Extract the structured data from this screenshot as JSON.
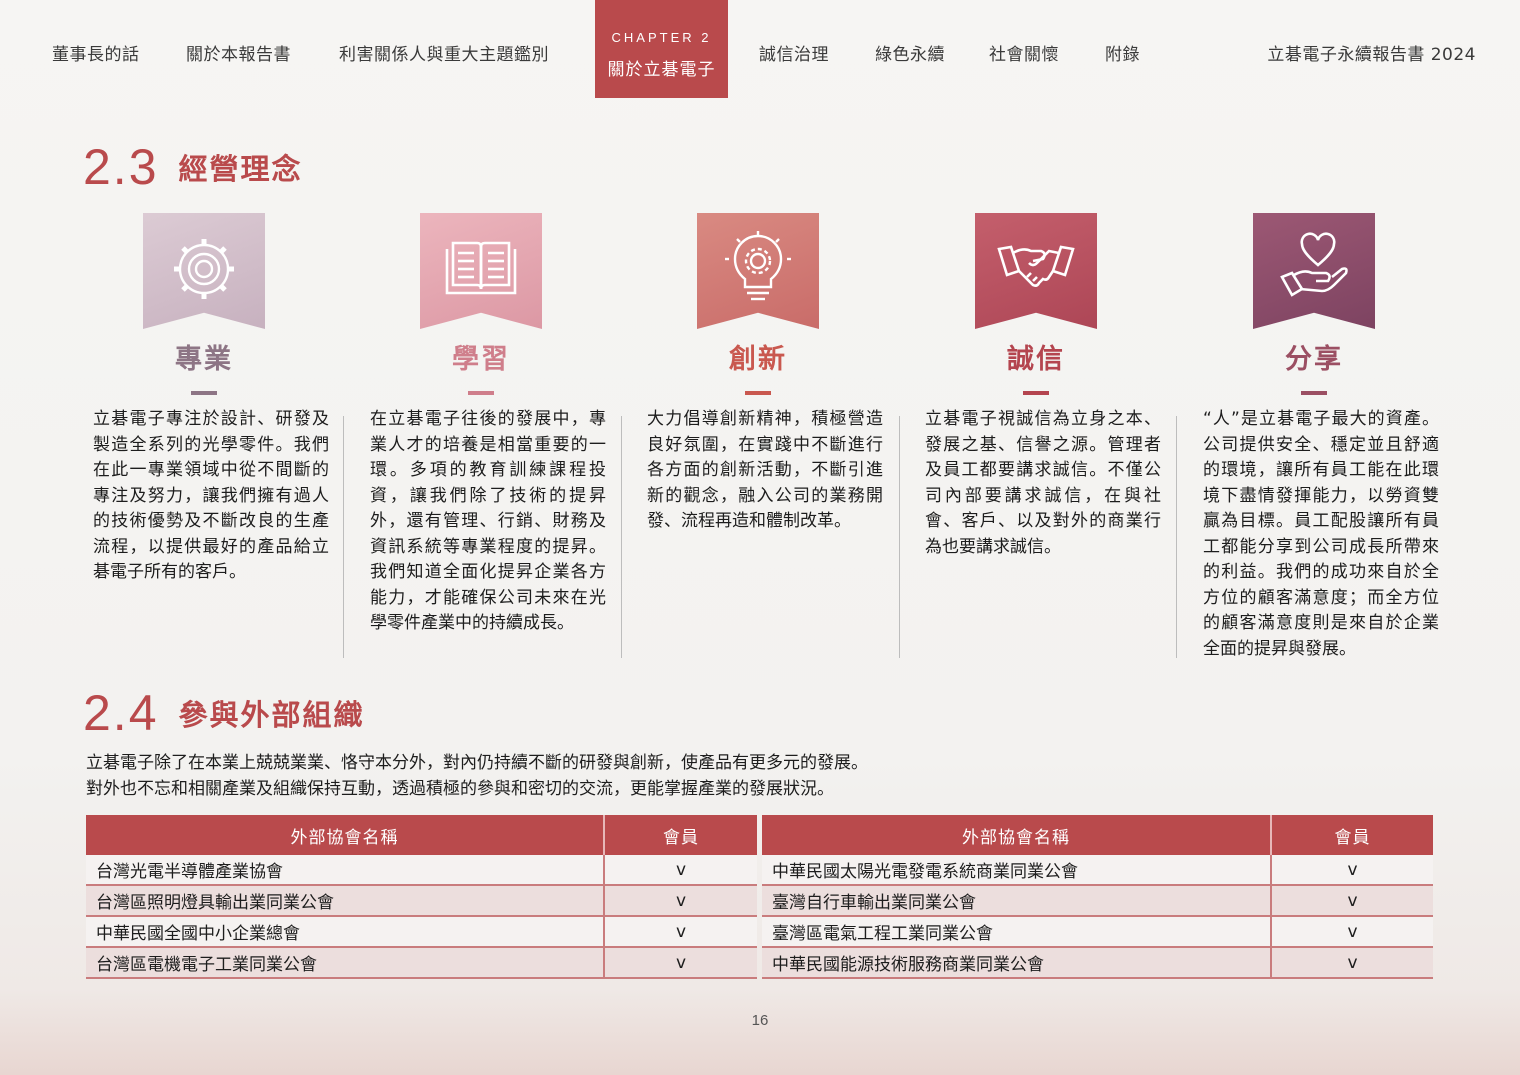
{
  "nav": {
    "items": [
      "董事長的話",
      "關於本報告書",
      "利害關係人與重大主題鑑別",
      "誠信治理",
      "綠色永續",
      "社會關懷",
      "附錄"
    ],
    "chapter_label": "CHAPTER 2",
    "chapter_name": "關於立碁電子",
    "report_title": "立碁電子永續報告書 2024"
  },
  "section_23": {
    "number": "2.3",
    "title": "經營理念"
  },
  "values": [
    {
      "name": "專業",
      "icon": "gear-icon",
      "color": "#8d7585",
      "banner": "#d4c3cc",
      "text": "立碁電子專注於設計、研發及製造全系列的光學零件。我們在此一專業領域中從不間斷的專注及努力，讓我們擁有過人的技術優勢及不斷改良的生產流程，以提供最好的產品給立碁電子所有的客戶。"
    },
    {
      "name": "學習",
      "icon": "book-icon",
      "color": "#cf7e8b",
      "banner": "#e3a2ad",
      "text": "在立碁電子往後的發展中，專業人才的培養是相當重要的一環。多項的教育訓練課程投資，讓我們除了技術的提昇外，還有管理、行銷、財務及資訊系統等專業程度的提昇。我們知道全面化提昇企業各方能力，才能確保公司未來在光學零件產業中的持續成長。"
    },
    {
      "name": "創新",
      "icon": "lightbulb-icon",
      "color": "#c9584f",
      "banner": "#cf7a75",
      "text": "大力倡導創新精神，積極營造良好氛圍，在實踐中不斷進行各方面的創新活動，不斷引進新的觀念，融入公司的業務開發、流程再造和體制改革。"
    },
    {
      "name": "誠信",
      "icon": "handshake-icon",
      "color": "#b4454f",
      "banner": "#b65261",
      "text": "立碁電子視誠信為立身之本、發展之基、信譽之源。管理者及員工都要講求誠信。不僅公司內部要講求誠信，在與社會、客戶、以及對外的商業行為也要講求誠信。"
    },
    {
      "name": "分享",
      "icon": "heart-hand-icon",
      "color": "#9b4f63",
      "banner": "#8f4d66",
      "text": "“人”是立碁電子最大的資產。公司提供安全、穩定並且舒適的環境，讓所有員工能在此環境下盡情發揮能力，以勞資雙贏為目標。員工配股讓所有員工都能分享到公司成長所帶來的利益。我們的成功來自於全方位的顧客滿意度；而全方位的顧客滿意度則是來自於企業全面的提昇與發展。"
    }
  ],
  "section_24": {
    "number": "2.4",
    "title": "參與外部組織",
    "intro_line1": "立碁電子除了在本業上兢兢業業、恪守本分外，對內仍持續不斷的研發與創新，使產品有更多元的發展。",
    "intro_line2": "對外也不忘和相關產業及組織保持互動，透過積極的參與和密切的交流，更能掌握產業的發展狀況。"
  },
  "tables": [
    {
      "headers": [
        "外部協會名稱",
        "會員"
      ],
      "rows": [
        [
          "台灣光電半導體產業協會",
          "v"
        ],
        [
          "台灣區照明燈具輸出業同業公會",
          "v"
        ],
        [
          "中華民國全國中小企業總會",
          "v"
        ],
        [
          "台灣區電機電子工業同業公會",
          "v"
        ]
      ]
    },
    {
      "headers": [
        "外部協會名稱",
        "會員"
      ],
      "rows": [
        [
          "中華民國太陽光電發電系統商業同業公會",
          "v"
        ],
        [
          "臺灣自行車輸出業同業公會",
          "v"
        ],
        [
          "臺灣區電氣工程工業同業公會",
          "v"
        ],
        [
          "中華民國能源技術服務商業同業公會",
          "v"
        ]
      ]
    }
  ],
  "page_number": "16"
}
